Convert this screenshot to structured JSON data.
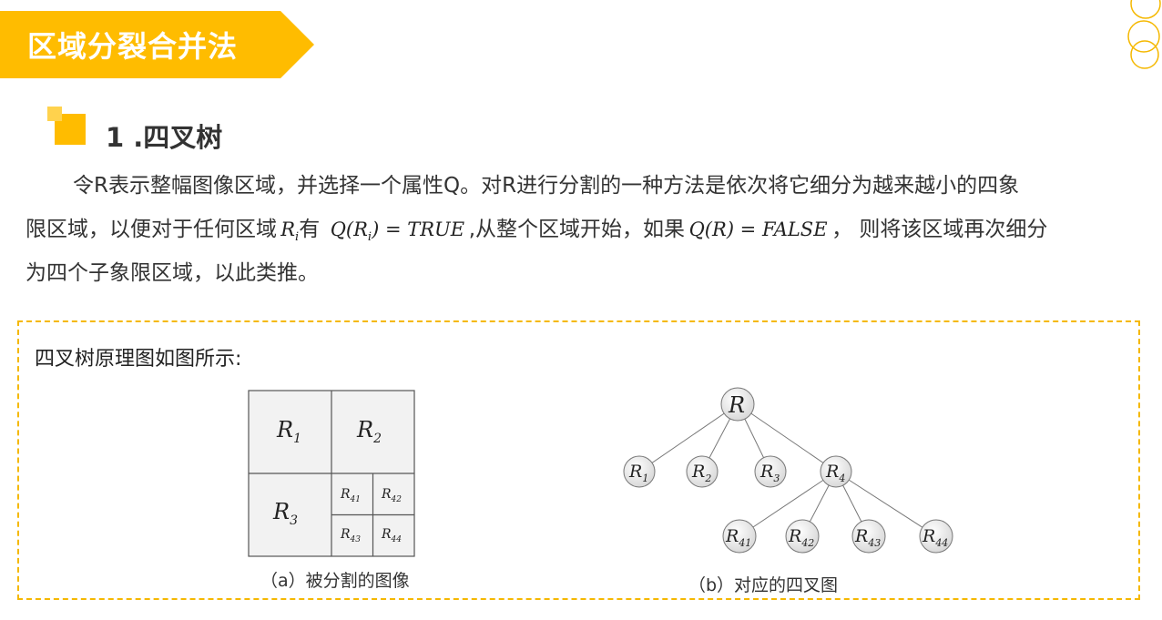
{
  "header": {
    "title": "区域分裂合并法",
    "accent_color": "#ffbc00"
  },
  "section": {
    "title": "1 .四叉树"
  },
  "paragraph": {
    "line1": "令R表示整幅图像区域，并选择一个属性Q。对R进行分割的一种方法是依次将它细分为越来越小的四象",
    "line2_a": "限区域，以便对于任何区域",
    "math_ri": "R",
    "math_ri_sub": "i",
    "line2_b": "有",
    "math_q1": "Q(R",
    "math_q1_sub": "i",
    "math_q1_end": ") = TRUE",
    "line2_c": ",从整个区域开始，如果",
    "math_q2": "Q(R) = FALSE",
    "line2_d": "， 则将该区域再次细分",
    "line3": "为四个子象限区域，以此类推。"
  },
  "figure_box": {
    "label_a": "四叉树原理图",
    "label_b": "如图所示:",
    "border_color": "#f5b800"
  },
  "figure_a": {
    "caption": "（a）被分割的图像",
    "cells": [
      {
        "base": "R",
        "sub": "1"
      },
      {
        "base": "R",
        "sub": "2"
      },
      {
        "base": "R",
        "sub": "3"
      },
      {
        "base": "R",
        "sub": "41"
      },
      {
        "base": "R",
        "sub": "42"
      },
      {
        "base": "R",
        "sub": "43"
      },
      {
        "base": "R",
        "sub": "44"
      }
    ]
  },
  "figure_b": {
    "caption": "（b）对应的四叉图",
    "root": {
      "base": "R",
      "sub": ""
    },
    "level1": [
      {
        "base": "R",
        "sub": "1"
      },
      {
        "base": "R",
        "sub": "2"
      },
      {
        "base": "R",
        "sub": "3"
      },
      {
        "base": "R",
        "sub": "4"
      }
    ],
    "level2": [
      {
        "base": "R",
        "sub": "41"
      },
      {
        "base": "R",
        "sub": "42"
      },
      {
        "base": "R",
        "sub": "43"
      },
      {
        "base": "R",
        "sub": "44"
      }
    ]
  }
}
